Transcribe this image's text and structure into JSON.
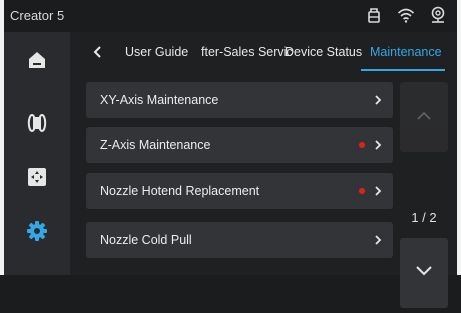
{
  "status_bar": {
    "device_name": "Creator 5",
    "icons": [
      "device-icon",
      "wifi-icon",
      "camera-icon"
    ]
  },
  "sidebar": {
    "items": [
      {
        "name": "home",
        "icon": "home-icon"
      },
      {
        "name": "filament",
        "icon": "filament-spool-icon"
      },
      {
        "name": "control",
        "icon": "move-control-icon"
      },
      {
        "name": "settings",
        "icon": "settings-gear-icon",
        "active": true
      }
    ],
    "active_color": "#33a8e6"
  },
  "nav": {
    "back_icon": "chevron-left-icon",
    "tabs": [
      {
        "label": "User Guide"
      },
      {
        "label": "fter-Sales Servic"
      },
      {
        "label": "Device Status"
      },
      {
        "label": "Maintenance",
        "active": true
      }
    ]
  },
  "maintenance_list": [
    {
      "label": "XY-Axis Maintenance",
      "alert": false
    },
    {
      "label": "Z-Axis Maintenance",
      "alert": true
    },
    {
      "label": "Nozzle Hotend Replacement",
      "alert": true
    },
    {
      "label": "Nozzle Cold Pull",
      "alert": false
    }
  ],
  "pager": {
    "label": "1 / 2",
    "current": 1,
    "total": 2
  },
  "colors": {
    "accent": "#33a8e6",
    "alert": "#e02020",
    "panel": "#333437",
    "background": "#1f2022"
  }
}
